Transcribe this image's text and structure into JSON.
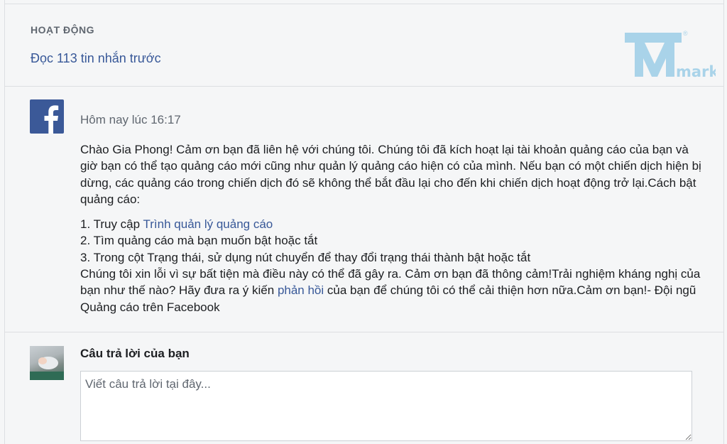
{
  "activity": {
    "title": "HOẠT ĐỘNG",
    "prev_messages_link": "Đọc 113 tin nhắn trước"
  },
  "watermark": {
    "letter": "M",
    "text": "mark",
    "registered": "®"
  },
  "message": {
    "sender_icon": "facebook-icon",
    "time": "Hôm nay lúc 16:17",
    "paragraph": "Chào Gia Phong! Cảm ơn bạn đã liên hệ với chúng tôi. Chúng tôi đã kích hoạt lại tài khoản quảng cáo của bạn và giờ bạn có thể tạo quảng cáo mới cũng như quản lý quảng cáo hiện có của mình. Nếu bạn có một chiến dịch hiện bị dừng, các quảng cáo trong chiến dịch đó sẽ không thể bắt đầu lại cho đến khi chiến dịch hoạt động trở lại.Cách bật quảng cáo:",
    "step1_prefix": "1. Truy cập ",
    "step1_link": "Trình quản lý quảng cáo",
    "step2": "2. Tìm quảng cáo mà bạn muốn bật hoặc tắt",
    "step3": "3. Trong cột Trạng thái, sử dụng nút chuyển để thay đổi trạng thái thành bật hoặc tắt",
    "closing_before_link": "Chúng tôi xin lỗi vì sự bất tiện mà điều này có thể đã gây ra. Cảm ơn bạn đã thông cảm!Trải nghiệm kháng nghị của bạn như thế nào? Hãy đưa ra ý kiến ",
    "feedback_link": "phản hồi",
    "closing_after_link": " của bạn để chúng tôi có thể cải thiện hơn nữa.Cảm ơn bạn!- Đội ngũ Quảng cáo trên Facebook"
  },
  "reply": {
    "title": "Câu trả lời của bạn",
    "placeholder": "Viết câu trả lời tại đây..."
  },
  "colors": {
    "link": "#385898",
    "facebook_blue": "#3b5998",
    "watermark": "#a9d3e9"
  }
}
